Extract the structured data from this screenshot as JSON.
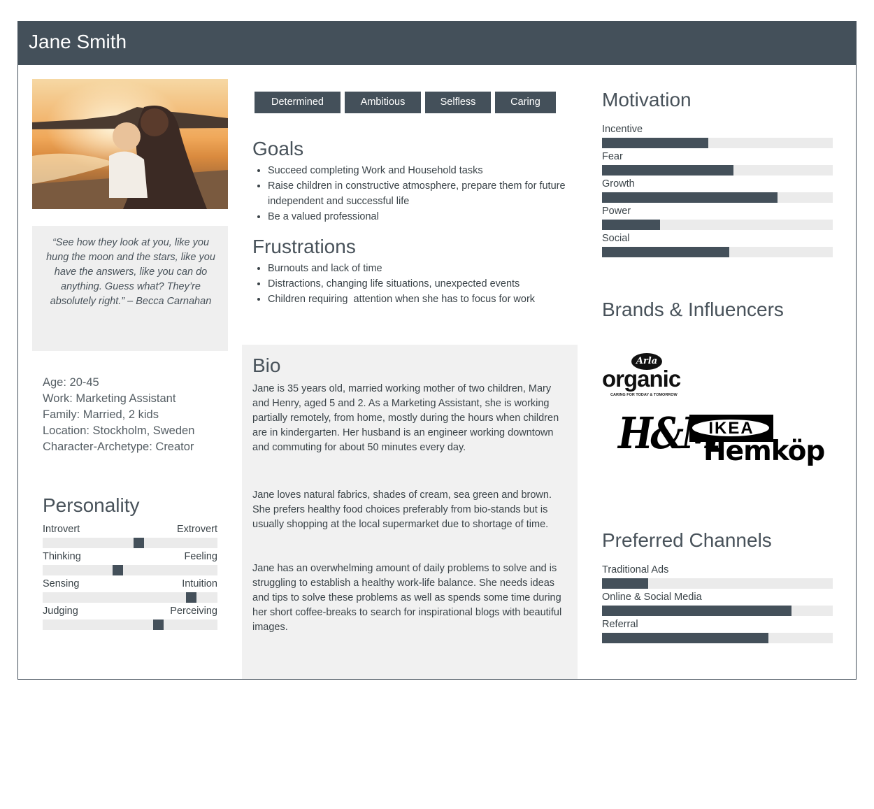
{
  "header": {
    "name": "Jane Smith"
  },
  "photo": {
    "alt": "Mother holding child on beach at sunset"
  },
  "quote": "“See how they look at you, like you hung the moon and the stars, like you have the answers, like you can do anything. Guess what? They’re absolutely right.” – Becca Carnahan",
  "demographics": [
    "Age: 20-45",
    "Work: Marketing Assistant",
    "Family: Married, 2 kids",
    "Location: Stockholm, Sweden",
    "Character-Archetype: Creator"
  ],
  "personality": {
    "title": "Personality",
    "rows": [
      {
        "left": "Introvert",
        "right": "Extrovert",
        "value": 0.55
      },
      {
        "left": "Thinking",
        "right": "Feeling",
        "value": 0.43
      },
      {
        "left": "Sensing",
        "right": "Intuition",
        "value": 0.85
      },
      {
        "left": "Judging",
        "right": "Perceiving",
        "value": 0.66
      }
    ]
  },
  "tags": [
    "Determined",
    "Ambitious",
    "Selfless",
    "Caring"
  ],
  "goals": {
    "title": "Goals",
    "items": [
      "Succeed completing Work and Household tasks",
      "Raise children in constructive atmosphere, prepare them for future independent and successful life",
      "Be a valued professional"
    ]
  },
  "frustrations": {
    "title": "Frustrations",
    "items": [
      "Burnouts and lack of time",
      "Distractions, changing life situations, unexpected events",
      "Children requiring  attention when she has to focus for work"
    ]
  },
  "bio": {
    "title": "Bio",
    "paragraphs": [
      "Jane is 35 years old, married working mother of two children, Mary and Henry, aged 5 and 2. As a Marketing Assistant, she is working partially remotely, from home, mostly during the hours when children are in kindergarten. Her husband is an engineer working downtown and commuting for about 50 minutes every day.",
      "Jane loves natural fabrics, shades of cream, sea green and brown. She prefers healthy food choices preferably from bio-stands but is usually shopping at the local supermarket due to shortage of time.",
      "Jane has an overwhelming amount of daily problems to solve and is struggling to establish a healthy work-life balance. She needs ideas and tips to solve these problems as well as spends some time during her short coffee-breaks to search for inspirational blogs with beautiful images."
    ]
  },
  "motivation": {
    "title": "Motivation",
    "items": [
      {
        "label": "Incentive",
        "value": 0.46
      },
      {
        "label": "Fear",
        "value": 0.57
      },
      {
        "label": "Growth",
        "value": 0.76
      },
      {
        "label": "Power",
        "value": 0.25
      },
      {
        "label": "Social",
        "value": 0.55
      }
    ]
  },
  "brands": {
    "title": "Brands & Influencers",
    "logos": [
      {
        "name": "Arla organic",
        "top": "Arla",
        "main": "organic",
        "sub": "CARING FOR TODAY & TOMORROW"
      },
      {
        "name": "H&M",
        "text": "H&M"
      },
      {
        "name": "IKEA",
        "text": "IKEA"
      },
      {
        "name": "Hemköp",
        "text": "Hemköp"
      }
    ]
  },
  "channels": {
    "title": "Preferred Channels",
    "items": [
      {
        "label": "Traditional Ads",
        "value": 0.2
      },
      {
        "label": "Online & Social Media",
        "value": 0.82
      },
      {
        "label": "Referral",
        "value": 0.72
      }
    ]
  },
  "colors": {
    "primary": "#44505a",
    "track": "#ebebeb",
    "panel": "#f1f1f1"
  }
}
